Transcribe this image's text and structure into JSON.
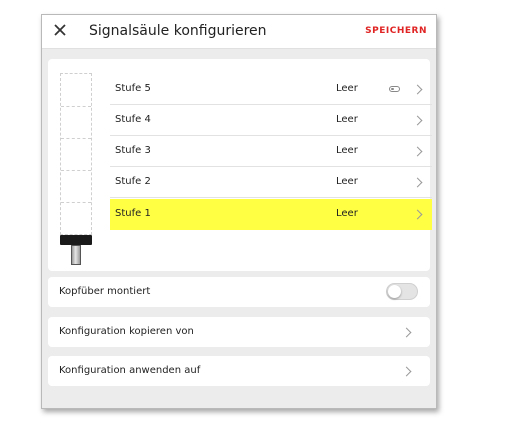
{
  "header": {
    "title": "Signalsäule konfigurieren",
    "save_label": "SPEICHERN"
  },
  "stages": [
    {
      "name": "Stufe 5",
      "value": "Leer",
      "has_toggle_icon": true,
      "active": false
    },
    {
      "name": "Stufe 4",
      "value": "Leer",
      "has_toggle_icon": false,
      "active": false
    },
    {
      "name": "Stufe 3",
      "value": "Leer",
      "has_toggle_icon": false,
      "active": false
    },
    {
      "name": "Stufe 2",
      "value": "Leer",
      "has_toggle_icon": false,
      "active": false
    },
    {
      "name": "Stufe 1",
      "value": "Leer",
      "has_toggle_icon": false,
      "active": true
    }
  ],
  "options": {
    "upside_down_label": "Kopfüber montiert",
    "upside_down_on": false,
    "copy_from_label": "Konfiguration kopieren von",
    "apply_to_label": "Konfiguration anwenden auf"
  },
  "colors": {
    "accent": "#e02424",
    "active_stage": "#ffff44"
  }
}
